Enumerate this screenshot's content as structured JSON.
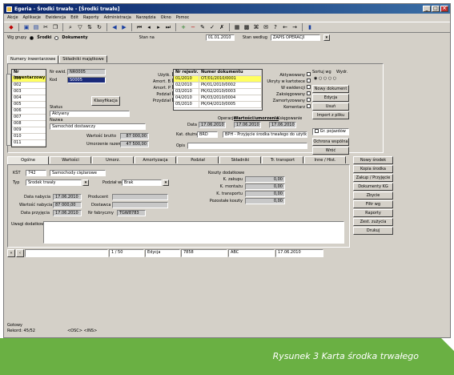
{
  "window": {
    "title": "Egeria - Środki trwałe - [Środki trwałe]"
  },
  "menu": [
    "Akcje",
    "Aplikacje",
    "Ewidencja",
    "Edit",
    "Raporty",
    "Administracja",
    "Narzędzia",
    "Okno",
    "Pomoc"
  ],
  "filterbar": {
    "label_group": "Wg grupy",
    "radio1": "Środki",
    "radio2": "Dokumenty",
    "label_status": "Stan na",
    "date_value": "01.01.2010",
    "label_dept": "Stan według",
    "dept_value": "ZAPIS OPERACJI"
  },
  "main_tabs": [
    "Numery inwentarzowe",
    "Składniki majątkowe"
  ],
  "inventory_list": {
    "header": "Nr inwentarzowy",
    "rows": [
      "001",
      "002",
      "003",
      "004",
      "005",
      "006",
      "007",
      "008",
      "009",
      "010",
      "011"
    ]
  },
  "detail": {
    "numer_label": "Nr ewid.",
    "numer_value": "NR0005",
    "kod_label": "Kod",
    "kod_value": "S0005",
    "button_classify": "Klasyfikacja",
    "status_label": "Status",
    "status_value": "Aktywny",
    "nazwa_label": "Nazwa",
    "nazwa_value": "Samochód dostawczy",
    "wartosc_label": "Wartość brutto",
    "wartosc_value": "87 000,00",
    "umorzenie_label": "Umorzenie razem",
    "umorzenie_value": "47 500,00"
  },
  "flags": [
    "Użytk.",
    "Amort. B",
    "Amort. P",
    "Podział",
    "Przydział"
  ],
  "documents": {
    "headers": [
      "Nr rejestr.",
      "Numer dokumentu"
    ],
    "rows": [
      [
        "01/2010",
        "OT/01/2010/0001"
      ],
      [
        "02/2010",
        "PK/01/2010/0002"
      ],
      [
        "03/2010",
        "PK/02/2010/0003"
      ],
      [
        "04/2010",
        "PK/03/2010/0004"
      ],
      [
        "05/2010",
        "PK/04/2010/0005"
      ]
    ],
    "subtabs_label1": "Operacje",
    "subtabs_label2": "Wartości/umorzenia",
    "subtabs_label3": "Księgowanie",
    "date_row_label": "Data",
    "dates": [
      "17.06.2010",
      "17.06.2010",
      "17.06.2010"
    ],
    "account_label": "Kat. dłużne",
    "account_value": "BRD",
    "account_desc": "BPH - Przyjęcie środka trwałego do użytkowania",
    "opis_label": "Opis"
  },
  "right_checks": [
    "Aktywowany",
    "Ukryty w kartotece",
    "W ewidencji",
    "Zaksięgowany",
    "Zamortyzowany",
    "Komentarz"
  ],
  "right_controls": {
    "sort_label": "Sortuj wg",
    "filter_label": "Wydr.",
    "buttons": [
      "Nowy dokument",
      "Edycja",
      "Usuń",
      "Import z pliku"
    ],
    "check_group": "Gr. pojazdów",
    "buttons2": [
      "Ochrona wspólna",
      "Wróć"
    ]
  },
  "side_buttons": [
    "Nowy środek",
    "Kopia środka",
    "Zakup / Przyjęcie",
    "Dokumenty KG",
    "Zbycie",
    "Filtr wg",
    "Raporty",
    "Zest. zużycia",
    "Drukuj"
  ],
  "bottom_tabs": [
    "Ogólne",
    "Wartości",
    "Umorz.",
    "Amortyzacja",
    "Podział",
    "Składniki",
    "Tr. transport",
    "Inne / Hist."
  ],
  "general": {
    "kst_label": "KŚT",
    "kst_value": "742",
    "kst_desc": "Samochody ciężarowe",
    "typ_label": "Typ",
    "typ_value": "Środek trwały",
    "podzial_label": "Podział wg",
    "podzial_value": "Brak",
    "data_label": "Data nabycia",
    "data_value": "17.06.2010",
    "wartosc_label": "Wartość nabycia",
    "wartosc_value": "87 000,00",
    "przyjecie_label": "Data przyjęcia",
    "przyjecie_value": "17.06.2010",
    "producent_label": "Producent",
    "dostawca_label": "Dostawca",
    "nr_fab_label": "Nr fabryczny",
    "nr_fab_value": "TGW8783",
    "uwagi_label": "Uwagi dodatkowe"
  },
  "amounts": {
    "header": "Koszty dodatkowe",
    "rows": [
      {
        "label": "K. zakupu",
        "value": "0,00"
      },
      {
        "label": "K. montażu",
        "value": "0,00"
      },
      {
        "label": "K. transportu",
        "value": "0,00"
      },
      {
        "label": "Pozostałe koszty",
        "value": "0,00"
      }
    ]
  },
  "nav": {
    "counter": "1 / 50",
    "state": "Edycja",
    "code": "7858",
    "user": "ABC",
    "date": "17.06.2010"
  },
  "status": {
    "line1": "Gotowy",
    "line2": "Rekord: 45/52",
    "line3": "<OSC> <INS>"
  },
  "caption": "Rysunek 3 Karta środka trwałego"
}
